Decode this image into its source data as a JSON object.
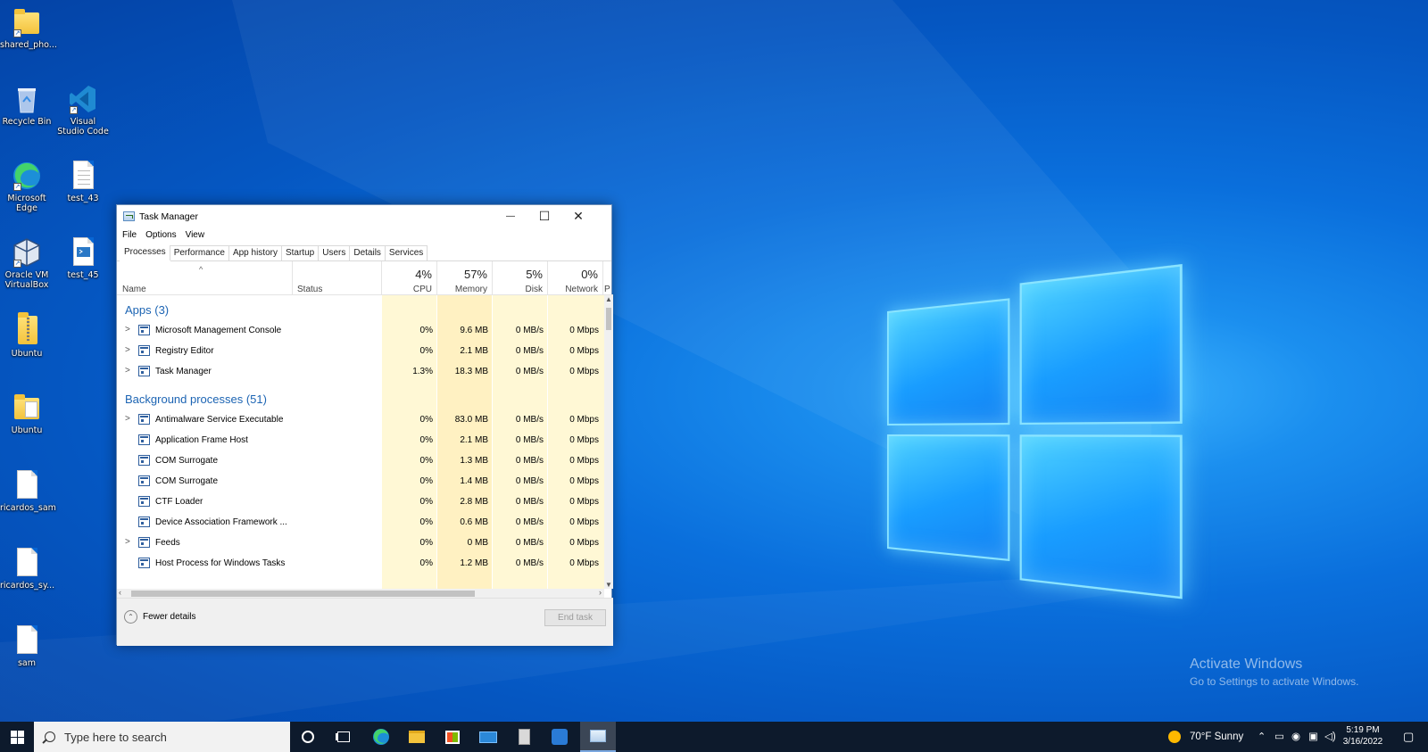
{
  "desktop": {
    "icons": [
      {
        "label": "shared_pho...",
        "kind": "folder"
      },
      {
        "label": "Recycle Bin",
        "kind": "recycle"
      },
      {
        "label": "Visual Studio Code",
        "kind": "vscode"
      },
      {
        "label": "Microsoft Edge",
        "kind": "edge"
      },
      {
        "label": "test_43",
        "kind": "doc"
      },
      {
        "label": "Oracle VM VirtualBox",
        "kind": "vbox"
      },
      {
        "label": "test_45",
        "kind": "script"
      },
      {
        "label": "Ubuntu",
        "kind": "zip"
      },
      {
        "label": "Ubuntu",
        "kind": "folderdoc"
      },
      {
        "label": "ricardos_sam",
        "kind": "blank"
      },
      {
        "label": "ricardos_sy...",
        "kind": "blank"
      },
      {
        "label": "sam",
        "kind": "blank"
      }
    ],
    "watermark": {
      "line1": "Activate Windows",
      "line2": "Go to Settings to activate Windows."
    }
  },
  "window": {
    "title": "Task Manager",
    "controls": {
      "minimize": "—",
      "maximize": "☐",
      "close": "✕"
    },
    "menu": [
      "File",
      "Options",
      "View"
    ],
    "tabs": [
      "Processes",
      "Performance",
      "App history",
      "Startup",
      "Users",
      "Details",
      "Services"
    ],
    "active_tab": "Processes",
    "sort_arrow": "^",
    "columns": {
      "name": "Name",
      "status": "Status",
      "cpu": {
        "pct": "4%",
        "label": "CPU"
      },
      "memory": {
        "pct": "57%",
        "label": "Memory"
      },
      "disk": {
        "pct": "5%",
        "label": "Disk"
      },
      "network": {
        "pct": "0%",
        "label": "Network"
      },
      "overflow": "P"
    },
    "groups": {
      "apps": "Apps (3)",
      "background": "Background processes (51)"
    },
    "apps": [
      {
        "name": "Microsoft Management Console",
        "cpu": "0%",
        "memory": "9.6 MB",
        "disk": "0 MB/s",
        "network": "0 Mbps",
        "expand": ">"
      },
      {
        "name": "Registry Editor",
        "cpu": "0%",
        "memory": "2.1 MB",
        "disk": "0 MB/s",
        "network": "0 Mbps",
        "expand": ">"
      },
      {
        "name": "Task Manager",
        "cpu": "1.3%",
        "memory": "18.3 MB",
        "disk": "0 MB/s",
        "network": "0 Mbps",
        "expand": ">"
      }
    ],
    "background": [
      {
        "name": "Antimalware Service Executable",
        "cpu": "0%",
        "memory": "83.0 MB",
        "disk": "0 MB/s",
        "network": "0 Mbps",
        "expand": ">"
      },
      {
        "name": "Application Frame Host",
        "cpu": "0%",
        "memory": "2.1 MB",
        "disk": "0 MB/s",
        "network": "0 Mbps",
        "expand": ""
      },
      {
        "name": "COM Surrogate",
        "cpu": "0%",
        "memory": "1.3 MB",
        "disk": "0 MB/s",
        "network": "0 Mbps",
        "expand": ""
      },
      {
        "name": "COM Surrogate",
        "cpu": "0%",
        "memory": "1.4 MB",
        "disk": "0 MB/s",
        "network": "0 Mbps",
        "expand": ""
      },
      {
        "name": "CTF Loader",
        "cpu": "0%",
        "memory": "2.8 MB",
        "disk": "0 MB/s",
        "network": "0 Mbps",
        "expand": ""
      },
      {
        "name": "Device Association Framework ...",
        "cpu": "0%",
        "memory": "0.6 MB",
        "disk": "0 MB/s",
        "network": "0 Mbps",
        "expand": ""
      },
      {
        "name": "Feeds",
        "cpu": "0%",
        "memory": "0 MB",
        "disk": "0 MB/s",
        "network": "0 Mbps",
        "expand": ">"
      },
      {
        "name": "Host Process for Windows Tasks",
        "cpu": "0%",
        "memory": "1.2 MB",
        "disk": "0 MB/s",
        "network": "0 Mbps",
        "expand": ""
      }
    ],
    "footer": {
      "fewer_details": "Fewer details",
      "end_task": "End task"
    }
  },
  "taskbar": {
    "search_placeholder": "Type here to search",
    "weather": "70°F  Sunny",
    "time": "5:19 PM",
    "date": "3/16/2022"
  },
  "colors": {
    "heat_light": "#fff8d5",
    "heat_medium": "#fff1c2",
    "group_blue": "#1c64b3",
    "taskbar": "#0d1a2c"
  }
}
